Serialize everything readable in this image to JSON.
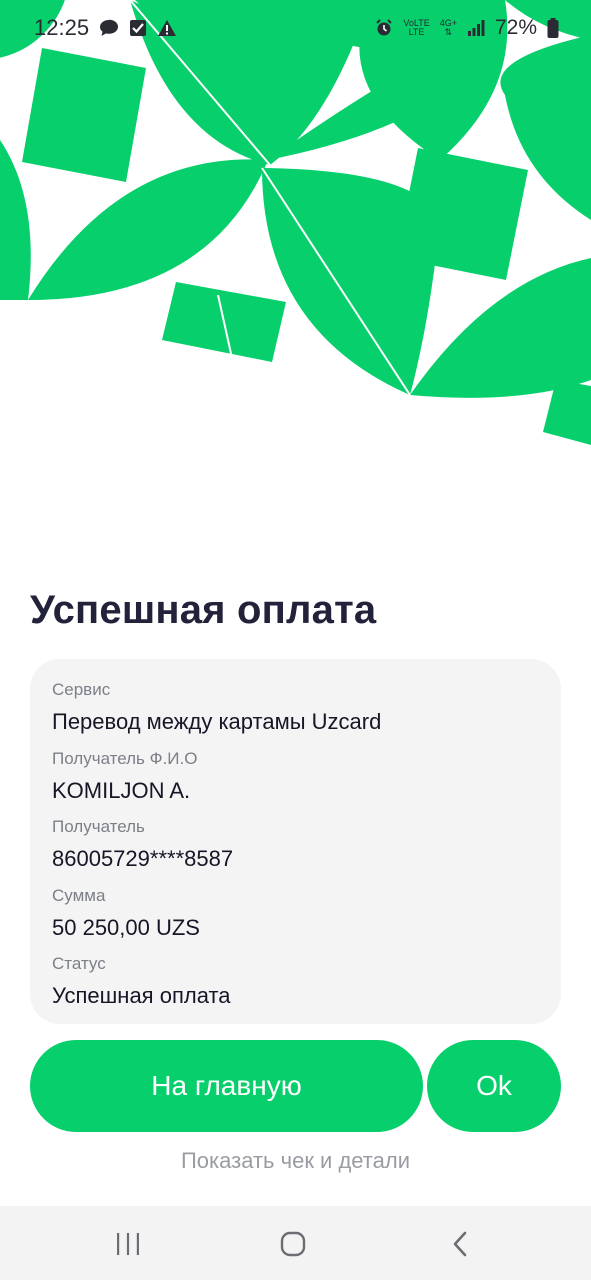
{
  "status_bar": {
    "time": "12:25",
    "network_top": "VoLTE",
    "network_bottom": "LTE",
    "net_4g": "4G+",
    "battery": "72%"
  },
  "title": "Успешная оплата",
  "details": [
    {
      "label": "Сервис",
      "value": "Перевод между картамы Uzcard"
    },
    {
      "label": "Получатель Ф.И.О",
      "value": "KOMILJON A."
    },
    {
      "label": "Получатель",
      "value": "86005729****8587"
    },
    {
      "label": "Сумма",
      "value": "50 250,00 UZS"
    },
    {
      "label": "Статус",
      "value": "Успешная оплата"
    }
  ],
  "buttons": {
    "home": "На главную",
    "ok": "Ok"
  },
  "link": "Показать чек и детали",
  "colors": {
    "accent": "#06cf6c",
    "card_bg": "#f4f4f5",
    "title": "#22223a"
  },
  "nav": {
    "recents": "recents-icon",
    "home": "home-icon",
    "back": "back-icon"
  }
}
